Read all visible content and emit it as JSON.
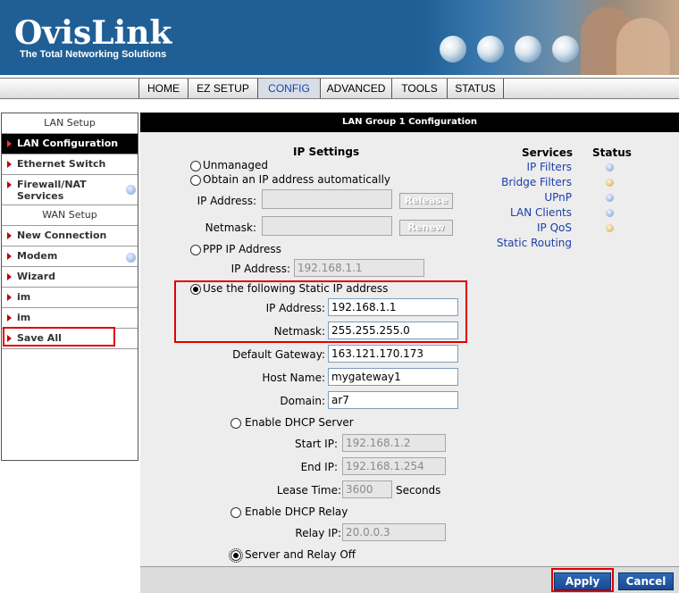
{
  "header": {
    "logo": "OvisLink",
    "tagline": "The Total Networking Solutions"
  },
  "nav": {
    "tabs": [
      {
        "label": "HOME",
        "active": false
      },
      {
        "label": "EZ SETUP",
        "active": false
      },
      {
        "label": "CONFIG",
        "active": true
      },
      {
        "label": "ADVANCED",
        "active": false
      },
      {
        "label": "TOOLS",
        "active": false
      },
      {
        "label": "STATUS",
        "active": false
      }
    ]
  },
  "sidebar": {
    "lan_header": "LAN Setup",
    "items": [
      {
        "label": "LAN Configuration",
        "active": true
      },
      {
        "label": "Ethernet Switch"
      },
      {
        "label": "Firewall/NAT Services"
      },
      {
        "label": "New Connection"
      },
      {
        "label": "Modem"
      },
      {
        "label": "Wizard"
      },
      {
        "label": "im"
      },
      {
        "label": "im"
      },
      {
        "label": "Save All"
      }
    ],
    "wan_header": "WAN Setup"
  },
  "main": {
    "title": "LAN Group 1 Configuration",
    "ip_settings": {
      "heading": "IP Settings",
      "unmanaged": "Unmanaged",
      "obtain_auto": "Obtain an IP address automatically",
      "ip_address_label": "IP Address:",
      "netmask_label": "Netmask:",
      "release": "Release",
      "renew": "Renew",
      "ppp": "PPP IP Address",
      "ppp_ip_label": "IP Address:",
      "ppp_ip_value": "192.168.1.1",
      "static": "Use the following Static IP address",
      "static_ip_label": "IP Address:",
      "static_ip_value": "192.168.1.1",
      "static_netmask_label": "Netmask:",
      "static_netmask_value": "255.255.255.0",
      "gateway_label": "Default Gateway:",
      "gateway_value": "163.121.170.173",
      "hostname_label": "Host Name:",
      "hostname_value": "mygateway1",
      "domain_label": "Domain:",
      "domain_value": "ar7"
    },
    "dhcp": {
      "enable_server": "Enable DHCP Server",
      "start_ip_label": "Start IP:",
      "start_ip_value": "192.168.1.2",
      "end_ip_label": "End IP:",
      "end_ip_value": "192.168.1.254",
      "lease_label": "Lease Time:",
      "lease_value": "3600",
      "lease_unit": "Seconds",
      "enable_relay": "Enable DHCP Relay",
      "relay_ip_label": "Relay IP:",
      "relay_ip_value": "20.0.0.3",
      "off": "Server and Relay Off"
    },
    "services": {
      "heading": "Services",
      "status_heading": "Status",
      "items": [
        {
          "label": "IP Filters",
          "status": "blue"
        },
        {
          "label": "Bridge Filters",
          "status": "orange"
        },
        {
          "label": "UPnP",
          "status": "blue"
        },
        {
          "label": "LAN Clients",
          "status": "blue"
        },
        {
          "label": "IP QoS",
          "status": "orange"
        },
        {
          "label": "Static Routing",
          "status": ""
        }
      ]
    }
  },
  "footer": {
    "apply": "Apply",
    "cancel": "Cancel"
  },
  "colors": {
    "header_blue": "#1f5f96",
    "highlight_red": "#e00000",
    "link_blue": "#1a3fa8",
    "button_blue": "#1a4a90"
  }
}
